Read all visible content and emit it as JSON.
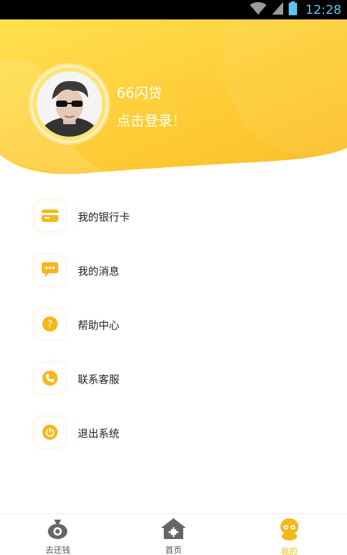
{
  "status_bar": {
    "time": "12:28"
  },
  "profile": {
    "app_name": "66闪贷",
    "login_prompt": "点击登录！"
  },
  "menu": [
    {
      "label": "我的银行卡",
      "icon": "bank-card-icon"
    },
    {
      "label": "我的消息",
      "icon": "message-icon"
    },
    {
      "label": "帮助中心",
      "icon": "help-icon"
    },
    {
      "label": "联系客服",
      "icon": "phone-icon"
    },
    {
      "label": "退出系统",
      "icon": "power-icon"
    }
  ],
  "bottom_nav": [
    {
      "label": "去还钱",
      "icon": "money-bag-icon",
      "active": false
    },
    {
      "label": "首页",
      "icon": "home-icon",
      "active": false
    },
    {
      "label": "我的",
      "icon": "profile-icon",
      "active": true
    }
  ],
  "colors": {
    "accent": "#f5b81c",
    "header_light": "#ffe04a",
    "header_dark": "#fcc02a",
    "inactive_icon": "#666666"
  }
}
